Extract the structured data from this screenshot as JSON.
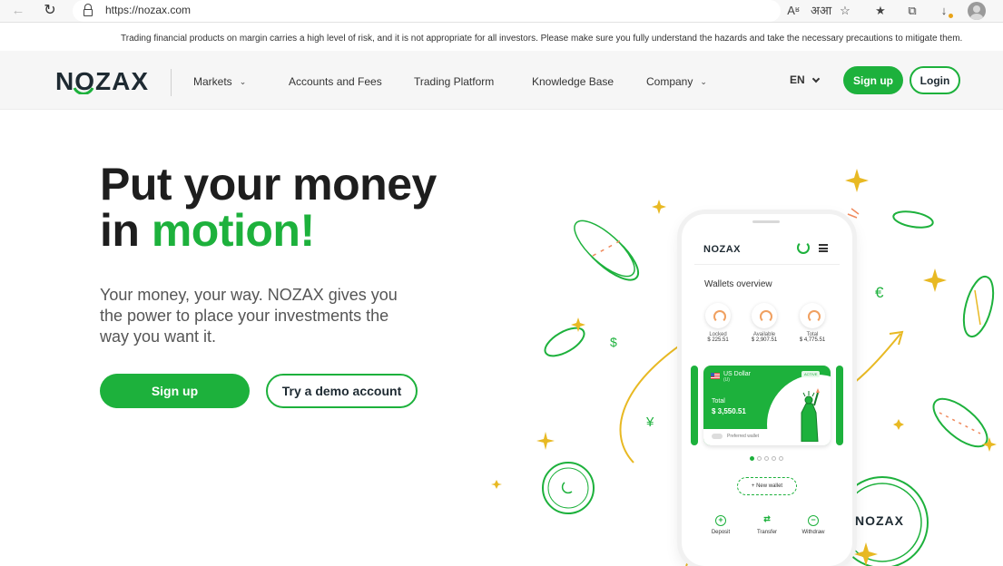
{
  "browser": {
    "url": "https://nozax.com",
    "back_icon": "←",
    "reload_icon": "↻",
    "tools": [
      "Aʶ",
      "अआ",
      "☆",
      "★",
      "⧉",
      "↓"
    ]
  },
  "risk_banner": {
    "text": "Trading financial products on margin carries a high level of risk, and it is not appropriate for all investors. Please make sure you fully understand the hazards and take the necessary precautions to mitigate them."
  },
  "header": {
    "logo": "NOZAX",
    "nav": [
      {
        "label": "Markets",
        "has_dropdown": true
      },
      {
        "label": "Accounts and Fees",
        "has_dropdown": false
      },
      {
        "label": "Trading Platform",
        "has_dropdown": false
      },
      {
        "label": "Knowledge Base",
        "has_dropdown": false
      },
      {
        "label": "Company",
        "has_dropdown": true
      }
    ],
    "language": "EN",
    "signup_label": "Sign up",
    "login_label": "Login"
  },
  "hero": {
    "title_line1": "Put your money",
    "title_line2_prefix": "in ",
    "title_accent": "motion!",
    "subtitle": "Your money, your way. NOZAX gives you the power to place your investments the way you want it.",
    "signup_label": "Sign up",
    "demo_label": "Try a demo account"
  },
  "phone": {
    "logo": "NOZAX",
    "wallets_title": "Wallets overview",
    "stats": [
      {
        "label": "Locked",
        "value": "$ 225.51"
      },
      {
        "label": "Available",
        "value": "$ 2,907.51"
      },
      {
        "label": "Total",
        "value": "$ 4,775.51"
      }
    ],
    "wallet": {
      "name": "US Dollar",
      "code": "(U)",
      "badge": "ACTIVE",
      "total_label": "Total",
      "total_value": "$ 3,550.51",
      "preferred_label": "Preferred wallet"
    },
    "new_wallet_label": "New wallet",
    "actions": [
      {
        "label": "Deposit",
        "icon": "+"
      },
      {
        "label": "Transfer",
        "icon": "⇄"
      },
      {
        "label": "Withdraw",
        "icon": "−"
      }
    ]
  },
  "decor": {
    "coin_text": "NOZAX",
    "currency_symbols": [
      "$",
      "€",
      "¥"
    ]
  },
  "colors": {
    "brand_green": "#1db13c",
    "dark": "#1e2a32",
    "sparkle": "#e8b923"
  }
}
